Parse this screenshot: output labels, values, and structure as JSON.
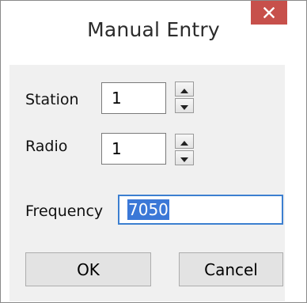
{
  "window": {
    "title": "Manual Entry",
    "close_icon": "close-icon",
    "close_color": "#c7504b"
  },
  "fields": {
    "station": {
      "label": "Station",
      "value": "1"
    },
    "radio": {
      "label": "Radio",
      "value": "1"
    },
    "frequency": {
      "label": "Frequency",
      "value": "7050"
    }
  },
  "spinner_icons": {
    "up": "triangle-up-icon",
    "down": "triangle-down-icon"
  },
  "buttons": {
    "ok": "OK",
    "cancel": "Cancel"
  },
  "colors": {
    "selection": "#3b78d7",
    "focus_border": "#3c7fd0",
    "client_bg": "#f0f0f0"
  }
}
